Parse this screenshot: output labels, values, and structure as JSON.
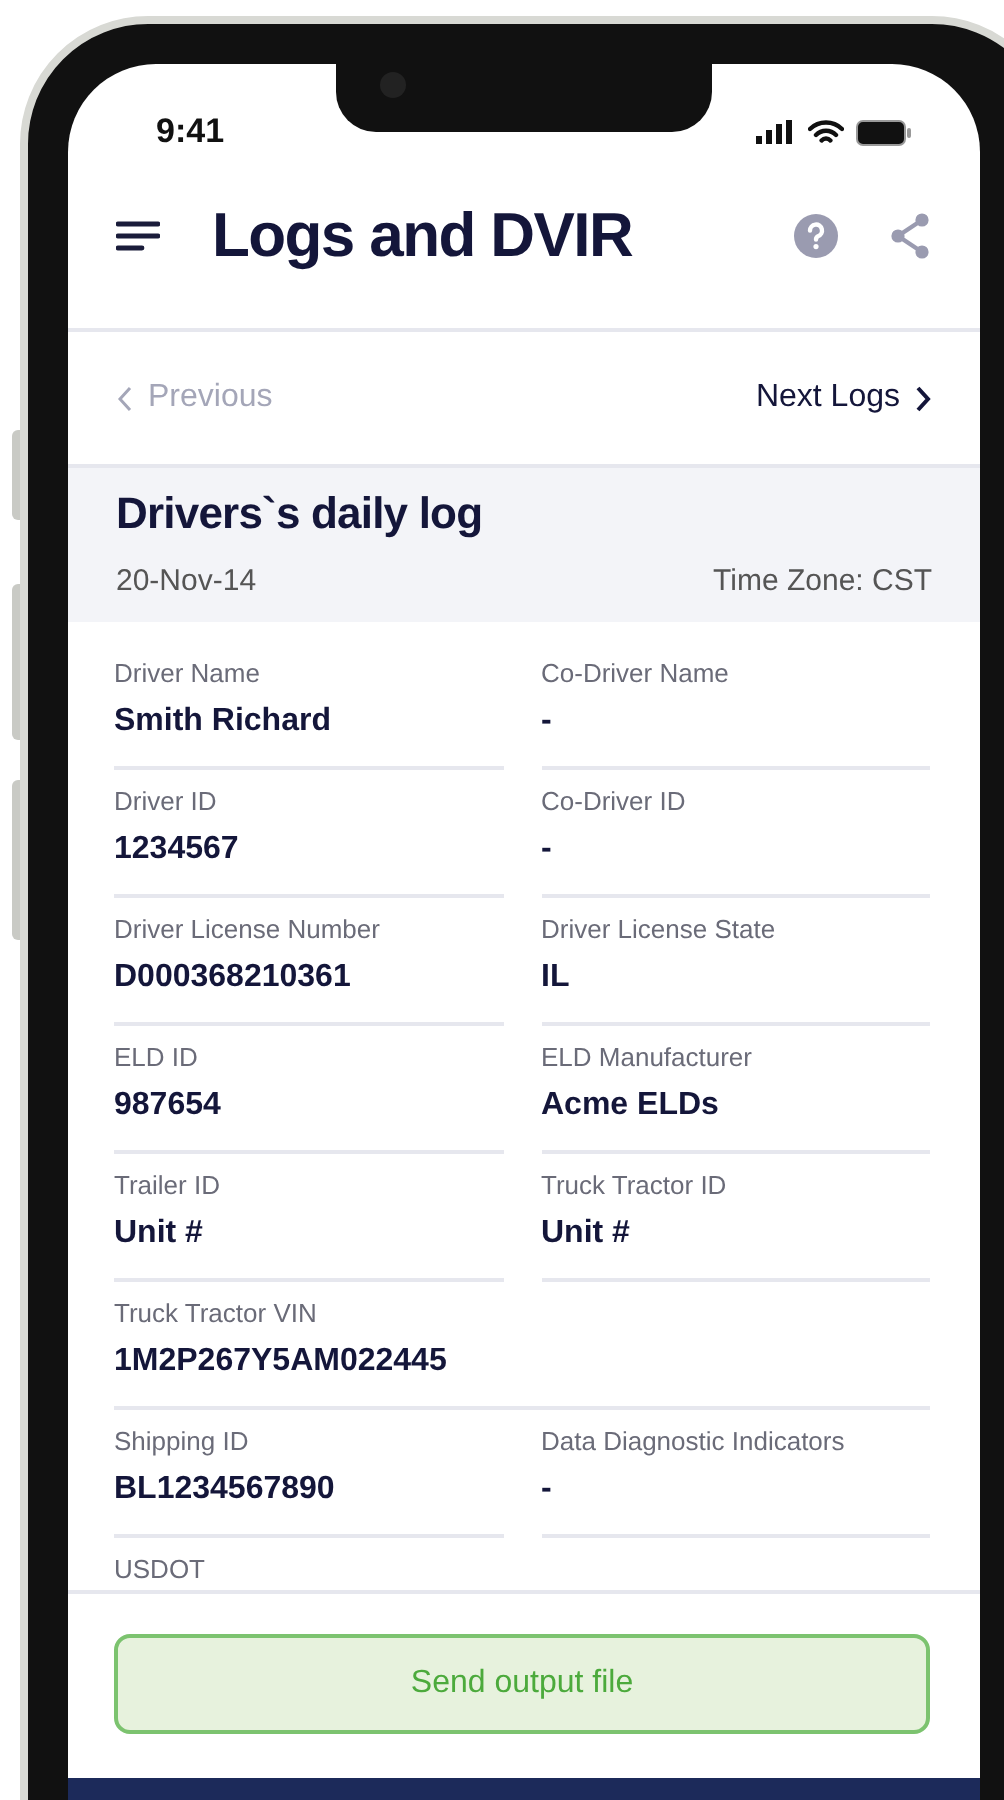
{
  "status_bar": {
    "time": "9:41"
  },
  "header": {
    "title": "Logs and DVIR"
  },
  "nav": {
    "previous": {
      "label": "Previous",
      "disabled": true
    },
    "next": {
      "label": "Next Logs",
      "disabled": false
    }
  },
  "log": {
    "title": "Drivers`s daily log",
    "date": "20-Nov-14",
    "time_zone": "Time Zone: CST"
  },
  "fields": [
    {
      "kind": "half",
      "label": "Driver Name",
      "value": "Smith Richard"
    },
    {
      "kind": "half",
      "label": "Co-Driver Name",
      "value": "-"
    },
    {
      "kind": "half",
      "label": "Driver ID",
      "value": "1234567"
    },
    {
      "kind": "half",
      "label": "Co-Driver ID",
      "value": "-"
    },
    {
      "kind": "half",
      "label": "Driver License Number",
      "value": "D000368210361"
    },
    {
      "kind": "half",
      "label": "Driver License State",
      "value": "IL"
    },
    {
      "kind": "half",
      "label": "ELD ID",
      "value": "987654"
    },
    {
      "kind": "half",
      "label": "ELD Manufacturer",
      "value": "Acme ELDs"
    },
    {
      "kind": "half",
      "label": "Trailer ID",
      "value": "Unit #"
    },
    {
      "kind": "half",
      "label": "Truck Tractor ID",
      "value": "Unit #"
    },
    {
      "kind": "full",
      "label": "Truck Tractor VIN",
      "value": "1M2P267Y5AM022445"
    },
    {
      "kind": "half",
      "label": "Shipping ID",
      "value": "BL1234567890"
    },
    {
      "kind": "half",
      "label": "Data Diagnostic Indicators",
      "value": "-"
    },
    {
      "kind": "half",
      "label": "USDOT"
    }
  ],
  "footer": {
    "button": "Send output file"
  }
}
